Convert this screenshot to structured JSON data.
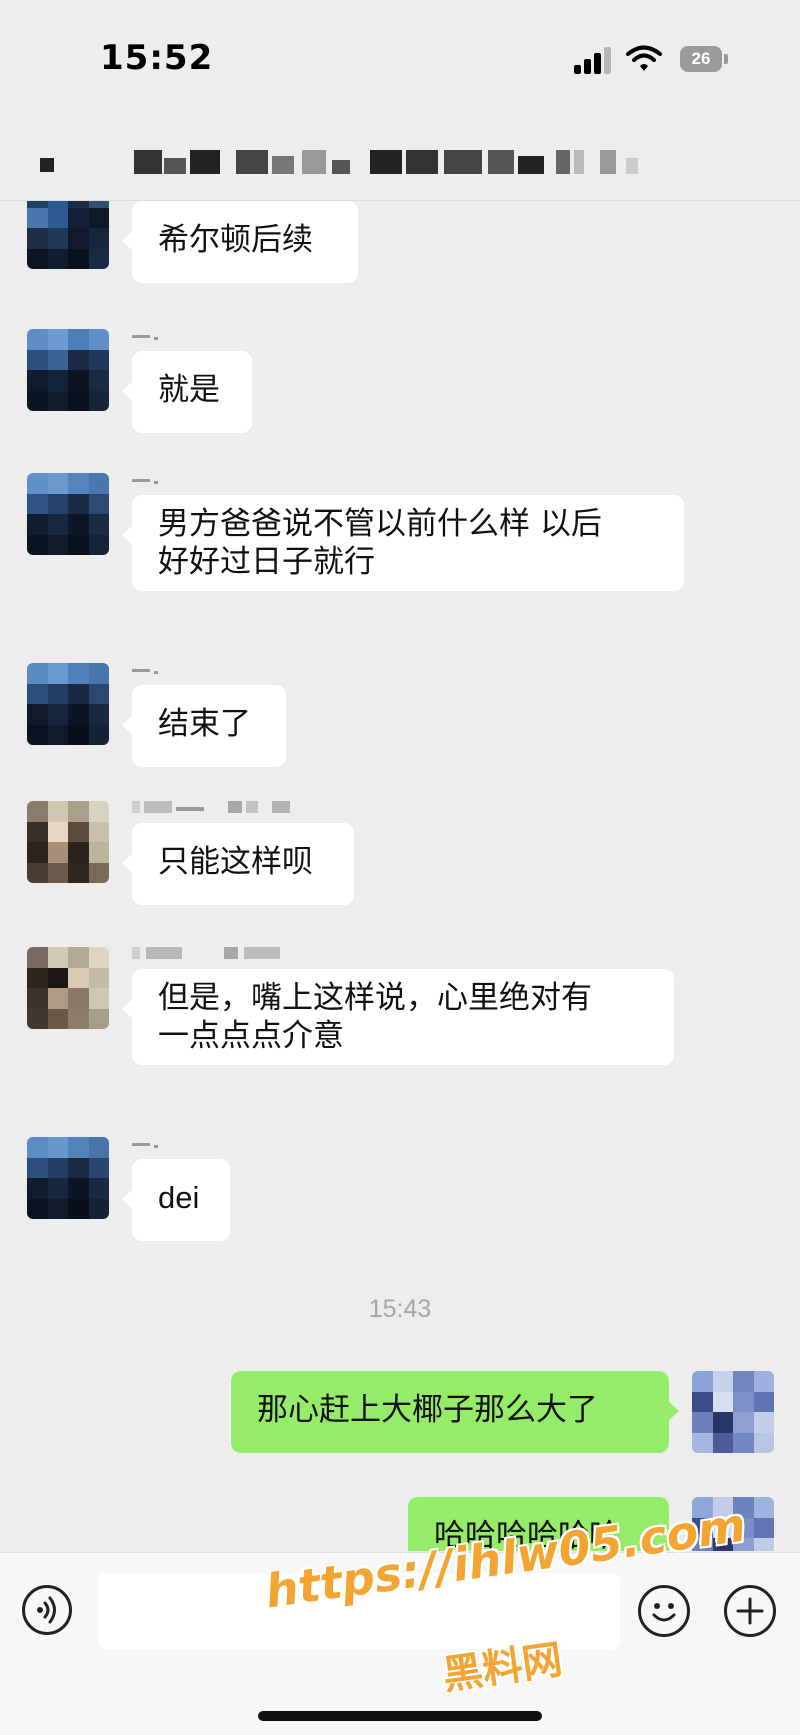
{
  "status_bar": {
    "time": "15:52",
    "battery": "26"
  },
  "chat": {
    "messages": [
      {
        "side": "left",
        "avatar": "blue",
        "text": "希尔顿后续"
      },
      {
        "side": "left",
        "avatar": "blue",
        "text": "就是"
      },
      {
        "side": "left",
        "avatar": "blue",
        "text": "男方爸爸说不管以前什么样 以后\n好好过日子就行"
      },
      {
        "side": "left",
        "avatar": "blue",
        "text": "结束了"
      },
      {
        "side": "left",
        "avatar": "beige",
        "text": "只能这样呗"
      },
      {
        "side": "left",
        "avatar": "beige",
        "text": "但是，嘴上这样说，心里绝对有\n一点点点介意"
      },
      {
        "side": "left",
        "avatar": "blue",
        "text": "dei"
      },
      {
        "side": "time",
        "text": "15:43"
      },
      {
        "side": "right",
        "avatar": "violet",
        "text": "那心赶上大椰子那么大了"
      },
      {
        "side": "right",
        "avatar": "violet",
        "text": "哈哈哈哈哈哈"
      }
    ]
  },
  "watermark": {
    "url": "https://ihlw05.com",
    "name": "黑料网"
  },
  "colors": {
    "bubble_in": "#ffffff",
    "bubble_out": "#95ec69",
    "background": "#ededed",
    "watermark": "#f3a431"
  },
  "icons": [
    "signal-icon",
    "wifi-icon",
    "battery-icon",
    "voice-icon",
    "emoji-icon",
    "plus-icon"
  ]
}
